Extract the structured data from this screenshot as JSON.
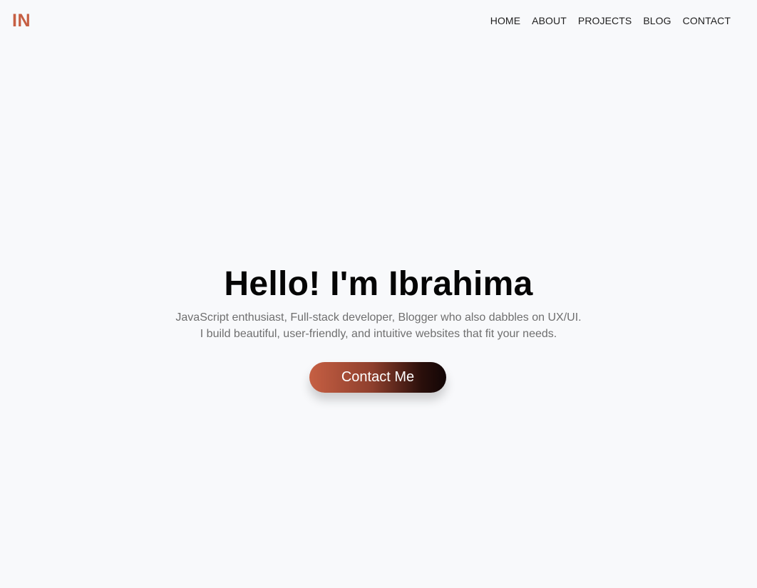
{
  "header": {
    "logo": "IN",
    "nav": [
      "HOME",
      "ABOUT",
      "PROJECTS",
      "BLOG",
      "CONTACT"
    ]
  },
  "hero": {
    "title": "Hello! I'm Ibrahima",
    "description_lines": [
      "JavaScript enthusiast, Full-stack developer, Blogger who also dabbles on UX/UI.",
      "I build beautiful, user-friendly, and intuitive websites that fit your needs."
    ],
    "button_label": "Contact Me"
  },
  "colors": {
    "accent": "#c65f43",
    "button_gradient_end": "#120606",
    "background": "#f8f9fb",
    "text_dark": "#050505",
    "text_muted": "#6f6f6f"
  }
}
